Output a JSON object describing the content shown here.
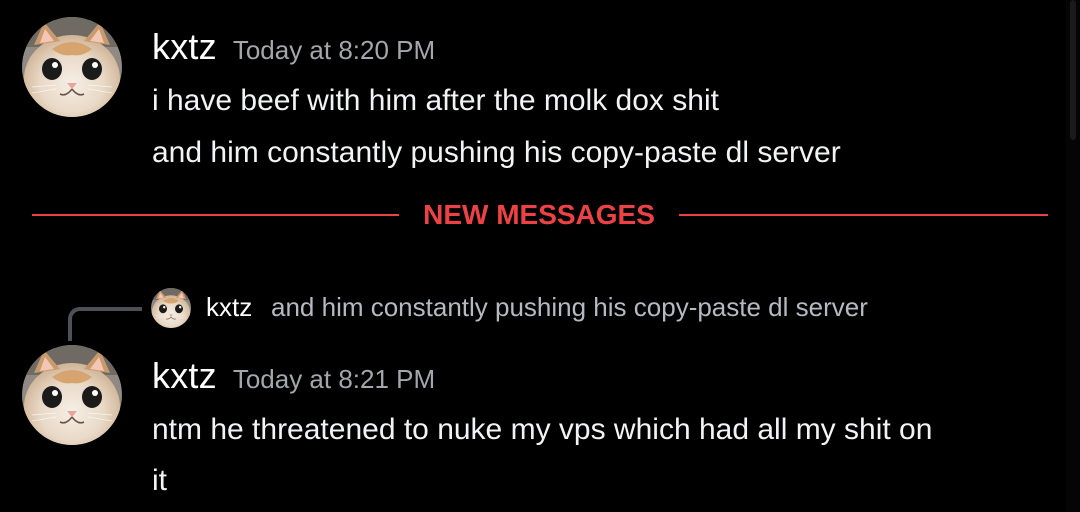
{
  "messages": [
    {
      "username": "kxtz",
      "timestamp": "Today at 8:20 PM",
      "lines": [
        "i have beef with him after the molk dox shit",
        "and him constantly pushing his copy-paste dl server"
      ],
      "avatar_icon": "cat-avatar-icon"
    },
    {
      "username": "kxtz",
      "timestamp": "Today at 8:21 PM",
      "lines": [
        "ntm he threatened to nuke my vps which had all my shit on",
        "it"
      ],
      "avatar_icon": "cat-avatar-icon"
    }
  ],
  "divider": {
    "label": "NEW MESSAGES",
    "color": "#ed4245"
  },
  "reply": {
    "username": "kxtz",
    "text": "and him constantly pushing his copy-paste dl server",
    "avatar_icon": "cat-avatar-icon"
  },
  "colors": {
    "background": "#000000",
    "username": "#ffffff",
    "timestamp": "#a3a6aa",
    "message_text": "#f2f3f5",
    "reply_text": "#b5bac1",
    "reply_spine": "#4e5058"
  }
}
